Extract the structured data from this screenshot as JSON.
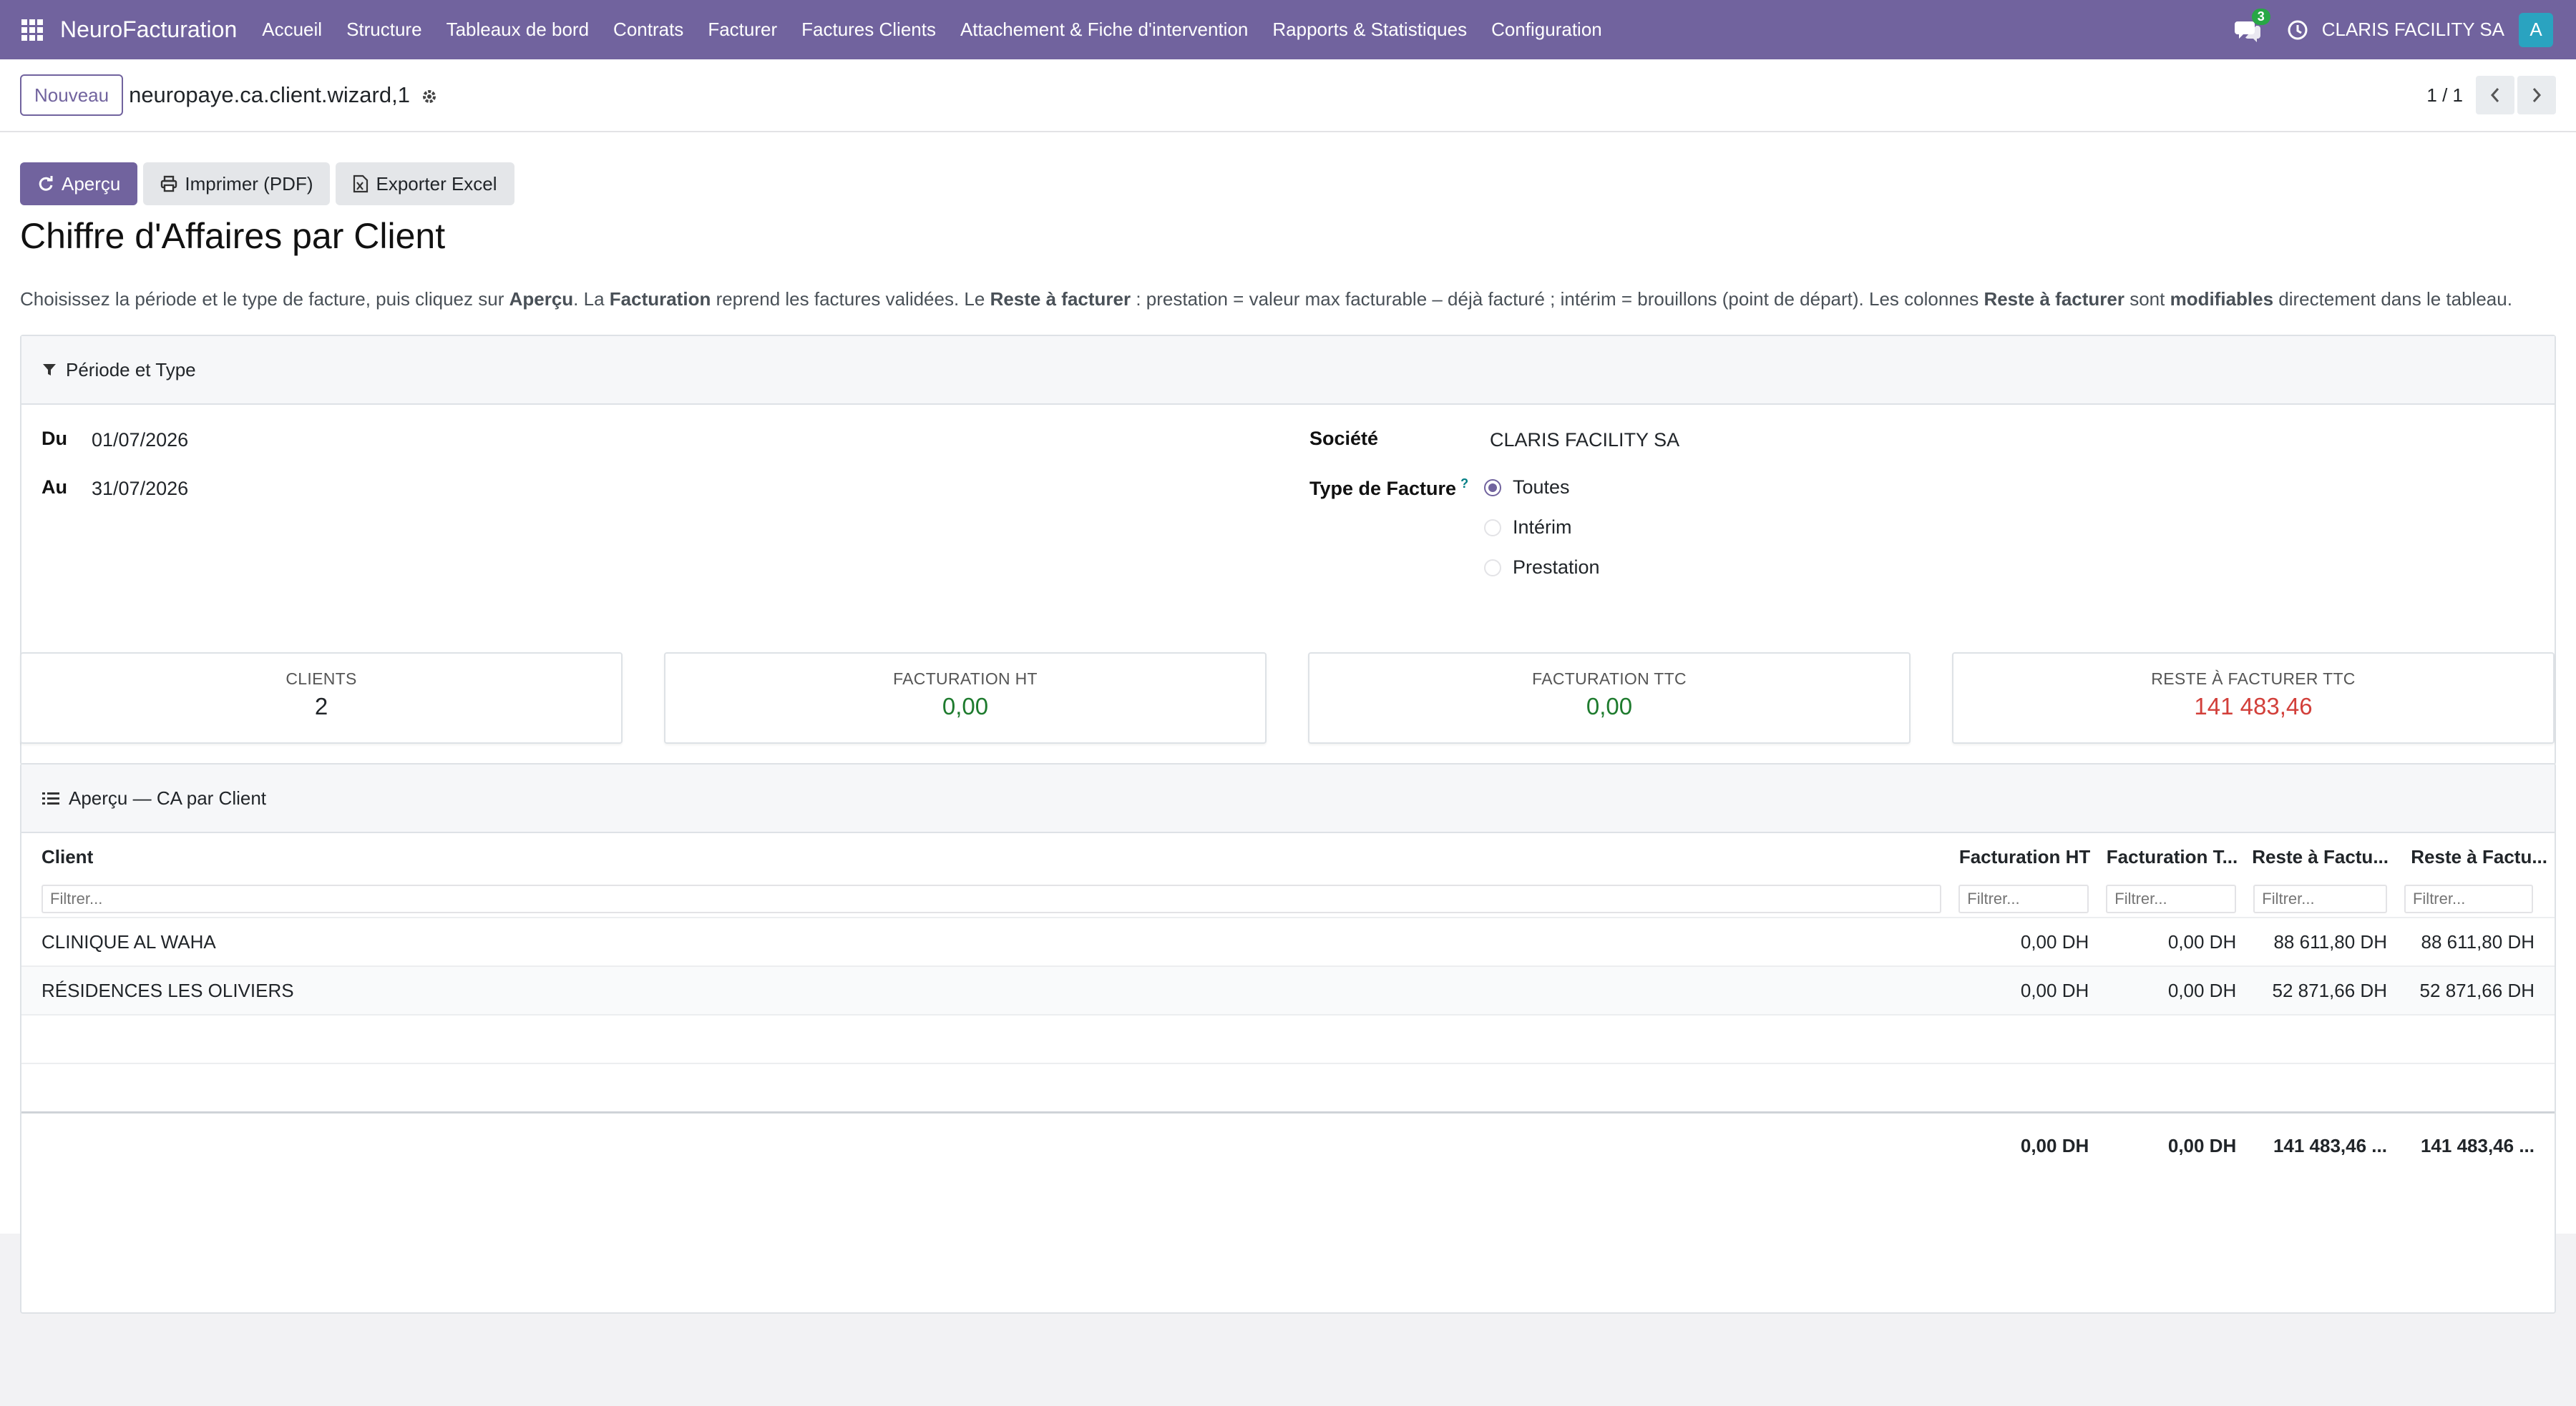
{
  "navbar": {
    "brand": "NeuroFacturation",
    "menu": [
      "Accueil",
      "Structure",
      "Tableaux de bord",
      "Contrats",
      "Facturer",
      "Factures Clients",
      "Attachement & Fiche d'intervention",
      "Rapports & Statistiques",
      "Configuration"
    ],
    "chat_badge": "3",
    "company": "CLARIS FACILITY SA",
    "avatar_letter": "A",
    "accent_color": "#71639e"
  },
  "control_panel": {
    "new_button": "Nouveau",
    "breadcrumb": "neuropaye.ca.client.wizard,1",
    "pager": "1 / 1"
  },
  "actions": {
    "preview": "Aperçu",
    "print": "Imprimer (PDF)",
    "export": "Exporter Excel"
  },
  "page_title": "Chiffre d'Affaires par Client",
  "helptext": {
    "p1": "Choisissez la période et le type de facture, puis cliquez sur ",
    "b1": "Aperçu",
    "p2": ". La ",
    "b2": "Facturation",
    "p3": " reprend les factures validées. Le ",
    "b3": "Reste à facturer",
    "p4": " : prestation = valeur max facturable – déjà facturé ; intérim = brouillons (point de départ). Les colonnes ",
    "b4": "Reste à facturer",
    "p5": " sont ",
    "b5": "modifiables",
    "p6": " directement dans le tableau."
  },
  "filters": {
    "heading": "Période et Type",
    "from_label": "Du",
    "from_value": "01/07/2026",
    "to_label": "Au",
    "to_value": "31/07/2026",
    "company_label": "Société",
    "company_value": "CLARIS FACILITY SA",
    "type_label": "Type de Facture",
    "help_mark": "?",
    "type_options": [
      "Toutes",
      "Intérim",
      "Prestation"
    ],
    "type_selected": "Toutes"
  },
  "kpis": [
    {
      "label": "Clients",
      "value": "2"
    },
    {
      "label": "Facturation HT",
      "value": "0,00"
    },
    {
      "label": "Facturation TTC",
      "value": "0,00"
    },
    {
      "label": "Reste à facturer TTC",
      "value": "141 483,46"
    }
  ],
  "table": {
    "heading": "Aperçu — CA par Client",
    "columns": [
      "Client",
      "Facturation HT",
      "Facturation T...",
      "Reste à Factu...",
      "Reste à Factu..."
    ],
    "filter_placeholder": "Filtrer...",
    "rows": [
      {
        "client": "CLINIQUE AL WAHA",
        "fact_ht": "0,00 DH",
        "fact_ttc": "0,00 DH",
        "reste_ht": "88 611,80 DH",
        "reste_ttc": "88 611,80 DH"
      },
      {
        "client": "RÉSIDENCES LES OLIVIERS",
        "fact_ht": "0,00 DH",
        "fact_ttc": "0,00 DH",
        "reste_ht": "52 871,66 DH",
        "reste_ttc": "52 871,66 DH"
      }
    ],
    "totals": {
      "fact_ht": "0,00 DH",
      "fact_ttc": "0,00 DH",
      "reste_ht": "141 483,46 ...",
      "reste_ttc": "141 483,46 ..."
    }
  }
}
